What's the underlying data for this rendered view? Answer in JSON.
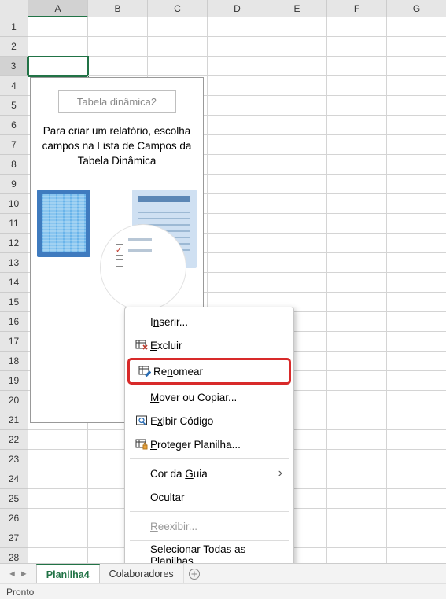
{
  "columns": [
    "A",
    "B",
    "C",
    "D",
    "E",
    "F",
    "G"
  ],
  "row_count": 29,
  "selected_cell": "A3",
  "pivot_placeholder": {
    "title": "Tabela dinâmica2",
    "message_line1": "Para criar um relatório, escolha",
    "message_line2": "campos na Lista de Campos da",
    "message_line3": "Tabela Dinâmica"
  },
  "context_menu": {
    "items": [
      {
        "key": "inserir",
        "label_pre": "I",
        "label_u": "n",
        "label_post": "serir...",
        "icon": "",
        "enabled": true
      },
      {
        "key": "excluir",
        "label_pre": "",
        "label_u": "E",
        "label_post": "xcluir",
        "icon": "grid-x",
        "enabled": true
      },
      {
        "key": "renomear",
        "label_pre": "Re",
        "label_u": "n",
        "label_post": "omear",
        "icon": "grid-pen",
        "enabled": true,
        "highlighted": true
      },
      {
        "key": "mover",
        "label_pre": "",
        "label_u": "M",
        "label_post": "over ou Copiar...",
        "icon": "",
        "enabled": true
      },
      {
        "key": "codigo",
        "label_pre": "E",
        "label_u": "x",
        "label_post": "ibir Código",
        "icon": "code",
        "enabled": true
      },
      {
        "key": "proteger",
        "label_pre": "",
        "label_u": "P",
        "label_post": "roteger Planilha...",
        "icon": "grid-lock",
        "enabled": true
      },
      {
        "key": "cor",
        "label_pre": "Cor da ",
        "label_u": "G",
        "label_post": "uia",
        "icon": "",
        "enabled": true,
        "submenu": true
      },
      {
        "key": "ocultar",
        "label_pre": "Oc",
        "label_u": "u",
        "label_post": "ltar",
        "icon": "",
        "enabled": true
      },
      {
        "key": "reexibir",
        "label_pre": "",
        "label_u": "R",
        "label_post": "eexibir...",
        "icon": "",
        "enabled": false
      },
      {
        "key": "selecionar",
        "label_pre": "",
        "label_u": "S",
        "label_post": "elecionar Todas as Planilhas",
        "icon": "",
        "enabled": true
      }
    ]
  },
  "sheet_tabs": {
    "tabs": [
      {
        "name": "Planilha4",
        "active": true
      },
      {
        "name": "Colaboradores",
        "active": false
      }
    ]
  },
  "status_bar": {
    "text": "Pronto"
  }
}
